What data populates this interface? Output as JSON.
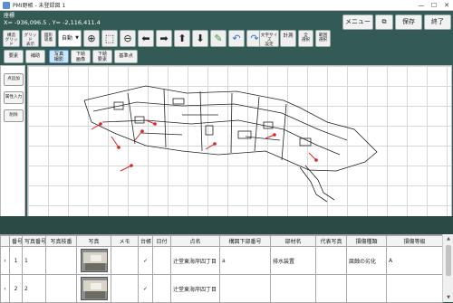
{
  "window": {
    "title": "PMI野帳 - 未登録図 1",
    "controls": [
      "—",
      "☐",
      "✕"
    ]
  },
  "header": {
    "section_label": "座標",
    "coords": "X= -936,096.5 , Y= -2,116,411.4"
  },
  "top_buttons": {
    "menu": "メニュー",
    "save": "保存",
    "exit": "終了"
  },
  "toolbar": {
    "snap_grid": [
      "構造",
      "グリッド"
    ],
    "grid_display": [
      "グリッド",
      "表示"
    ],
    "auto_snap": [
      "図形",
      "吸着"
    ],
    "auto_select": "自動",
    "text_size": [
      "文字サイズ",
      "設定"
    ],
    "measure": "計測",
    "select_all": [
      "全",
      "選択"
    ],
    "range_select": [
      "範囲",
      "選択"
    ]
  },
  "modes": {
    "elements": "要素",
    "assist": "補助",
    "photo": [
      "写真",
      "撮影"
    ],
    "lower_image": [
      "下絵",
      "画像"
    ],
    "lower_element": [
      "下絵",
      "要素"
    ],
    "base_point": "基準点"
  },
  "sidebar": {
    "btn_add_point": "点追加",
    "btn_input": "属性入力",
    "btn_delete": "削除"
  },
  "table": {
    "headers": [
      "番号",
      "写真番号",
      "写真枝番",
      "写真",
      "メモ",
      "台帳",
      "日付",
      "点名",
      "構図下部番号",
      "部材名",
      "代表写真",
      "損傷種類",
      "損傷等級"
    ],
    "rows": [
      {
        "index": "1",
        "photo_no": "1",
        "photo_branch": "",
        "memo": "",
        "ledger": "✓",
        "date": "",
        "point_name": "辻堂東海岸四丁目",
        "sub_no": "a",
        "member": "排水装置",
        "rep_photo": "",
        "damage_type": "腐蝕の劣化",
        "damage_grade": "A"
      },
      {
        "index": "2",
        "photo_no": "2",
        "photo_branch": "",
        "memo": "",
        "ledger": "✓",
        "date": "",
        "point_name": "辻堂東海岸四丁目",
        "sub_no": "",
        "member": "",
        "rep_photo": "",
        "damage_type": "",
        "damage_grade": ""
      }
    ]
  },
  "colors": {
    "background": "#335a54",
    "map_line": "#222222",
    "marker_red": "#e02020",
    "active_mode": "#cfe3f6"
  }
}
